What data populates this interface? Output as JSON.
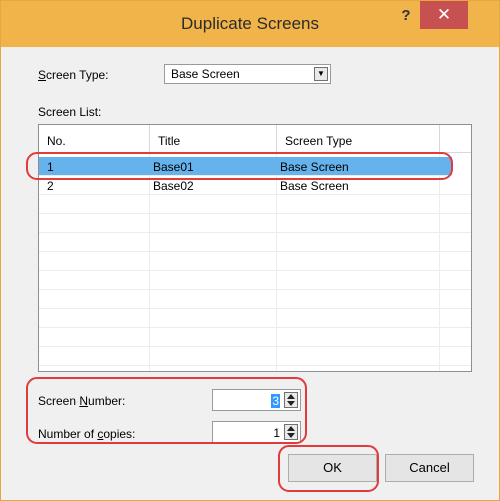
{
  "dialog": {
    "title": "Duplicate Screens",
    "help_label": "?",
    "close_label": "✕"
  },
  "screen_type": {
    "label_pre": "",
    "label_access": "S",
    "label_post": "creen Type:",
    "value": "Base Screen",
    "dropdown_glyph": "▼"
  },
  "screen_list": {
    "label": "Screen List:",
    "columns": [
      "No.",
      "Title",
      "Screen Type"
    ],
    "rows": [
      {
        "no": "1",
        "title": "Base01",
        "type": "Base Screen",
        "selected": true
      },
      {
        "no": "2",
        "title": "Base02",
        "type": "Base Screen",
        "selected": false
      }
    ]
  },
  "screen_number": {
    "label_pre": "Screen ",
    "label_access": "N",
    "label_post": "umber:",
    "value": "3"
  },
  "copies": {
    "label_pre": "Number of ",
    "label_access": "c",
    "label_post": "opies:",
    "value": "1"
  },
  "buttons": {
    "ok": "OK",
    "cancel": "Cancel"
  },
  "colors": {
    "title_bar": "#f0b44a",
    "close": "#c75050",
    "selection": "#66b2ec",
    "highlight_outline": "#e23b3b"
  }
}
